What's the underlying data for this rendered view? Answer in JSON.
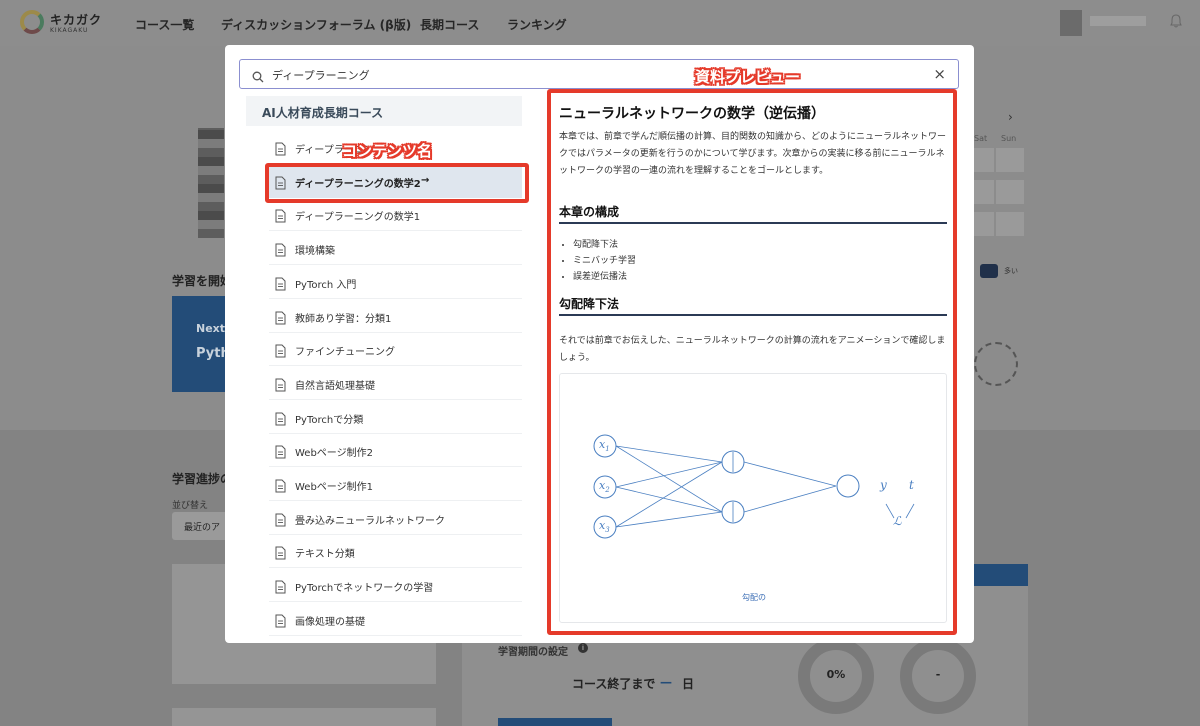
{
  "header": {
    "logo_text": "キカガク",
    "logo_sub": "KIKAGAKU",
    "nav": [
      "コース一覧",
      "ディスカッションフォーラム (β版)",
      "長期コース",
      "ランキング"
    ]
  },
  "background": {
    "start_heading": "学習を開始",
    "next_label": "Next:",
    "next_course": "Pyth",
    "progress_heading": "学習進捗の",
    "sort_label": "並び替え",
    "sort_value": "最近のア",
    "days_of_week": [
      "Sat",
      "Sun"
    ],
    "legend_more": "多い",
    "study_period_label": "学習期間の設定",
    "course_end_label": "コース終了まで",
    "course_end_value": "—",
    "course_end_unit": "日",
    "ring1_value": "0%",
    "ring2_value": "-"
  },
  "modal": {
    "search": {
      "value": "ディープラーニング"
    },
    "course_title": "AI人材育成長期コース",
    "items": [
      {
        "label": "ディープラーニング"
      },
      {
        "label": "ディープラーニングの数学2",
        "active": true,
        "arrow": "→"
      },
      {
        "label": "ディープラーニングの数学1"
      },
      {
        "label": "環境構築"
      },
      {
        "label": "PyTorch 入門"
      },
      {
        "label": "教師あり学習：分類1"
      },
      {
        "label": "ファインチューニング"
      },
      {
        "label": "自然言語処理基礎"
      },
      {
        "label": "PyTorchで分類"
      },
      {
        "label": "Webページ制作2"
      },
      {
        "label": "Webページ制作1"
      },
      {
        "label": "畳み込みニューラルネットワーク"
      },
      {
        "label": "テキスト分類"
      },
      {
        "label": "PyTorchでネットワークの学習"
      },
      {
        "label": "画像処理の基礎"
      }
    ],
    "preview": {
      "title": "ニューラルネットワークの数学（逆伝播）",
      "intro": "本章では、前章で学んだ順伝播の計算、目的関数の知識から、どのようにニューラルネットワークではパラメータの更新を行うのかについて学びます。次章からの実装に移る前にニューラルネットワークの学習の一連の流れを理解することをゴールとします。",
      "section1": "本章の構成",
      "bullets": [
        "勾配降下法",
        "ミニバッチ学習",
        "誤差逆伝播法"
      ],
      "section2": "勾配降下法",
      "text2": "それでは前章でお伝えした、ニューラルネットワークの計算の流れをアニメーションで確認しましょう。",
      "figure": {
        "inputs": [
          "x",
          "x",
          "x"
        ],
        "input_subs": [
          "1",
          "2",
          "3"
        ],
        "y": "y",
        "t": "t",
        "loss": "ℒ",
        "caption": "勾配の"
      }
    }
  },
  "annotations": {
    "content_name": "コンテンツ名",
    "preview": "資料プレビュー"
  },
  "colors": {
    "annotation_red": "#e53a2a",
    "search_border": "#8b8fd0",
    "active_item": "#dfe6ee",
    "heading_rule": "#2b3a55",
    "figure_blue": "#4a7fc1"
  }
}
